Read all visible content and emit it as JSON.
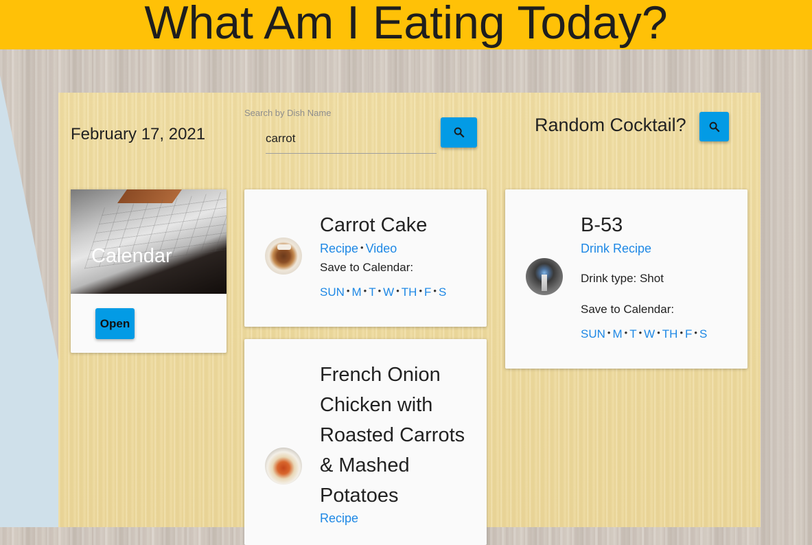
{
  "header": {
    "title": "What Am I Eating Today?"
  },
  "date": "February 17, 2021",
  "search": {
    "label": "Search by Dish Name",
    "value": "carrot",
    "button_icon": "search-icon"
  },
  "cocktail": {
    "title": "Random Cocktail?",
    "button_icon": "search-icon"
  },
  "calendar_card": {
    "title": "Calendar",
    "button_label": "Open"
  },
  "dishes": [
    {
      "title": "Carrot Cake",
      "links": [
        "Recipe",
        "Video"
      ],
      "save_label": "Save to Calendar:",
      "days": [
        "SUN",
        "M",
        "T",
        "W",
        "TH",
        "F",
        "S"
      ]
    },
    {
      "title": "French Onion Chicken with Roasted Carrots & Mashed Potatoes",
      "links": [
        "Recipe"
      ]
    }
  ],
  "drink": {
    "title": "B-53",
    "link": "Drink Recipe",
    "type_text": "Drink type: Shot",
    "save_label": "Save to Calendar:",
    "days": [
      "SUN",
      "M",
      "T",
      "W",
      "TH",
      "F",
      "S"
    ]
  },
  "colors": {
    "header": "#ffc107",
    "button": "#039be5",
    "link": "#1e88e5"
  }
}
